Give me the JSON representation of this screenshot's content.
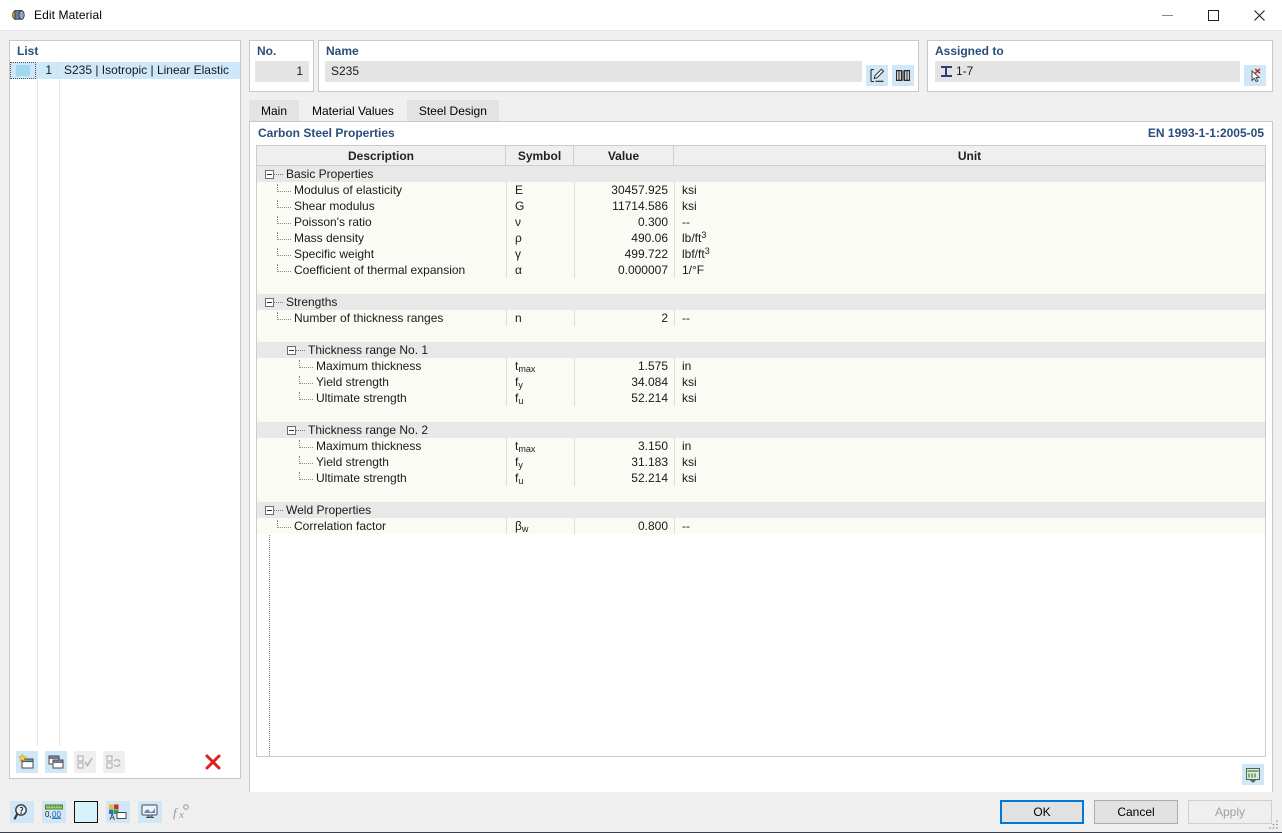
{
  "window": {
    "title": "Edit Material",
    "icon": "material-icon",
    "minimize": "minimize-icon",
    "maximize": "maximize-icon",
    "close": "close-icon"
  },
  "list_panel": {
    "header": "List",
    "rows": [
      {
        "number": "1",
        "label": "S235 | Isotropic | Linear Elastic"
      }
    ],
    "toolbar": [
      {
        "name": "new-material-button",
        "icon": "new-window-star-icon",
        "enabled": true
      },
      {
        "name": "copy-material-button",
        "icon": "copy-window-icon",
        "enabled": true
      },
      {
        "name": "select-all-button",
        "icon": "checklist-check-icon",
        "enabled": false
      },
      {
        "name": "invert-selection-button",
        "icon": "checklist-swap-icon",
        "enabled": false
      },
      {
        "name": "delete-material-button",
        "icon": "red-x-icon",
        "enabled": true
      }
    ]
  },
  "header": {
    "no_label": "No.",
    "no_value": "1",
    "name_label": "Name",
    "name_value": "S235",
    "name_placeholder": "",
    "edit_button": "edit-pencil-icon",
    "library_button": "book-library-icon",
    "assigned_label": "Assigned to",
    "assigned_value": "1-7",
    "assigned_icon": "i-beam-member-icon",
    "assigned_pick_button": "deselect-cursor-icon"
  },
  "tabs": [
    {
      "label": "Main",
      "active": false
    },
    {
      "label": "Material Values",
      "active": true
    },
    {
      "label": "Steel Design",
      "active": false
    }
  ],
  "panel": {
    "title": "Carbon Steel Properties",
    "code": "EN 1993-1-1:2005-05",
    "corner_button": "table-export-icon"
  },
  "table": {
    "columns": [
      "Description",
      "Symbol",
      "Value",
      "Unit"
    ],
    "rows": [
      {
        "kind": "group",
        "indent": 0,
        "description": "Basic Properties"
      },
      {
        "kind": "leaf",
        "indent": 1,
        "description": "Modulus of elasticity",
        "symbol": "E",
        "value": "30457.925",
        "unit": "ksi"
      },
      {
        "kind": "leaf",
        "indent": 1,
        "description": "Shear modulus",
        "symbol": "G",
        "value": "11714.586",
        "unit": "ksi"
      },
      {
        "kind": "leaf",
        "indent": 1,
        "description": "Poisson's ratio",
        "symbol": "ν",
        "value": "0.300",
        "unit": "--"
      },
      {
        "kind": "leaf",
        "indent": 1,
        "description": "Mass density",
        "symbol": "ρ",
        "value": "490.06",
        "unit": "lb/ft³"
      },
      {
        "kind": "leaf",
        "indent": 1,
        "description": "Specific weight",
        "symbol": "γ",
        "value": "499.722",
        "unit": "lbf/ft³"
      },
      {
        "kind": "leaf",
        "indent": 1,
        "description": "Coefficient of thermal expansion",
        "symbol": "α",
        "value": "0.000007",
        "unit": "1/°F"
      },
      {
        "kind": "spacer"
      },
      {
        "kind": "group",
        "indent": 0,
        "description": "Strengths"
      },
      {
        "kind": "leaf",
        "indent": 1,
        "description": "Number of thickness ranges",
        "symbol": "n",
        "value": "2",
        "unit": "--"
      },
      {
        "kind": "spacer"
      },
      {
        "kind": "group",
        "indent": 1,
        "description": "Thickness range No. 1"
      },
      {
        "kind": "leaf",
        "indent": 2,
        "description": "Maximum thickness",
        "symbol": "t",
        "symbol_sub": "max",
        "value": "1.575",
        "unit": "in"
      },
      {
        "kind": "leaf",
        "indent": 2,
        "description": "Yield strength",
        "symbol": "f",
        "symbol_sub": "y",
        "value": "34.084",
        "unit": "ksi"
      },
      {
        "kind": "leaf",
        "indent": 2,
        "description": "Ultimate strength",
        "symbol": "f",
        "symbol_sub": "u",
        "value": "52.214",
        "unit": "ksi"
      },
      {
        "kind": "spacer"
      },
      {
        "kind": "group",
        "indent": 1,
        "description": "Thickness range No. 2"
      },
      {
        "kind": "leaf",
        "indent": 2,
        "description": "Maximum thickness",
        "symbol": "t",
        "symbol_sub": "max",
        "value": "3.150",
        "unit": "in"
      },
      {
        "kind": "leaf",
        "indent": 2,
        "description": "Yield strength",
        "symbol": "f",
        "symbol_sub": "y",
        "value": "31.183",
        "unit": "ksi"
      },
      {
        "kind": "leaf",
        "indent": 2,
        "description": "Ultimate strength",
        "symbol": "f",
        "symbol_sub": "u",
        "value": "52.214",
        "unit": "ksi"
      },
      {
        "kind": "spacer"
      },
      {
        "kind": "group",
        "indent": 0,
        "description": "Weld Properties"
      },
      {
        "kind": "leaf",
        "indent": 1,
        "description": "Correlation factor",
        "symbol": "β",
        "symbol_sub": "w",
        "value": "0.800",
        "unit": "--"
      }
    ]
  },
  "bottom": {
    "tools": [
      {
        "name": "info-search-button",
        "icon": "magnifier-info-icon",
        "enabled": true
      },
      {
        "name": "units-button",
        "icon": "decimal-places-icon",
        "enabled": true
      },
      {
        "name": "color-swatch-button",
        "icon": "color-swatch-icon",
        "enabled": true
      },
      {
        "name": "render-settings-button",
        "icon": "color-legend-icon",
        "enabled": true
      },
      {
        "name": "display-properties-button",
        "icon": "display-monitor-icon",
        "enabled": true
      },
      {
        "name": "formula-button",
        "icon": "function-fx-icon",
        "enabled": false
      }
    ],
    "ok": "OK",
    "cancel": "Cancel",
    "apply": "Apply",
    "apply_enabled": false
  },
  "colors": {
    "accent_blue": "#2a4d7a",
    "selection_blue": "#cde8fa",
    "button_blue": "#cfe7f7",
    "focus_blue": "#0078d7",
    "delete_red": "#e02020",
    "row_bg": "#fbfbf5",
    "group_bg": "#e8e8e8"
  }
}
